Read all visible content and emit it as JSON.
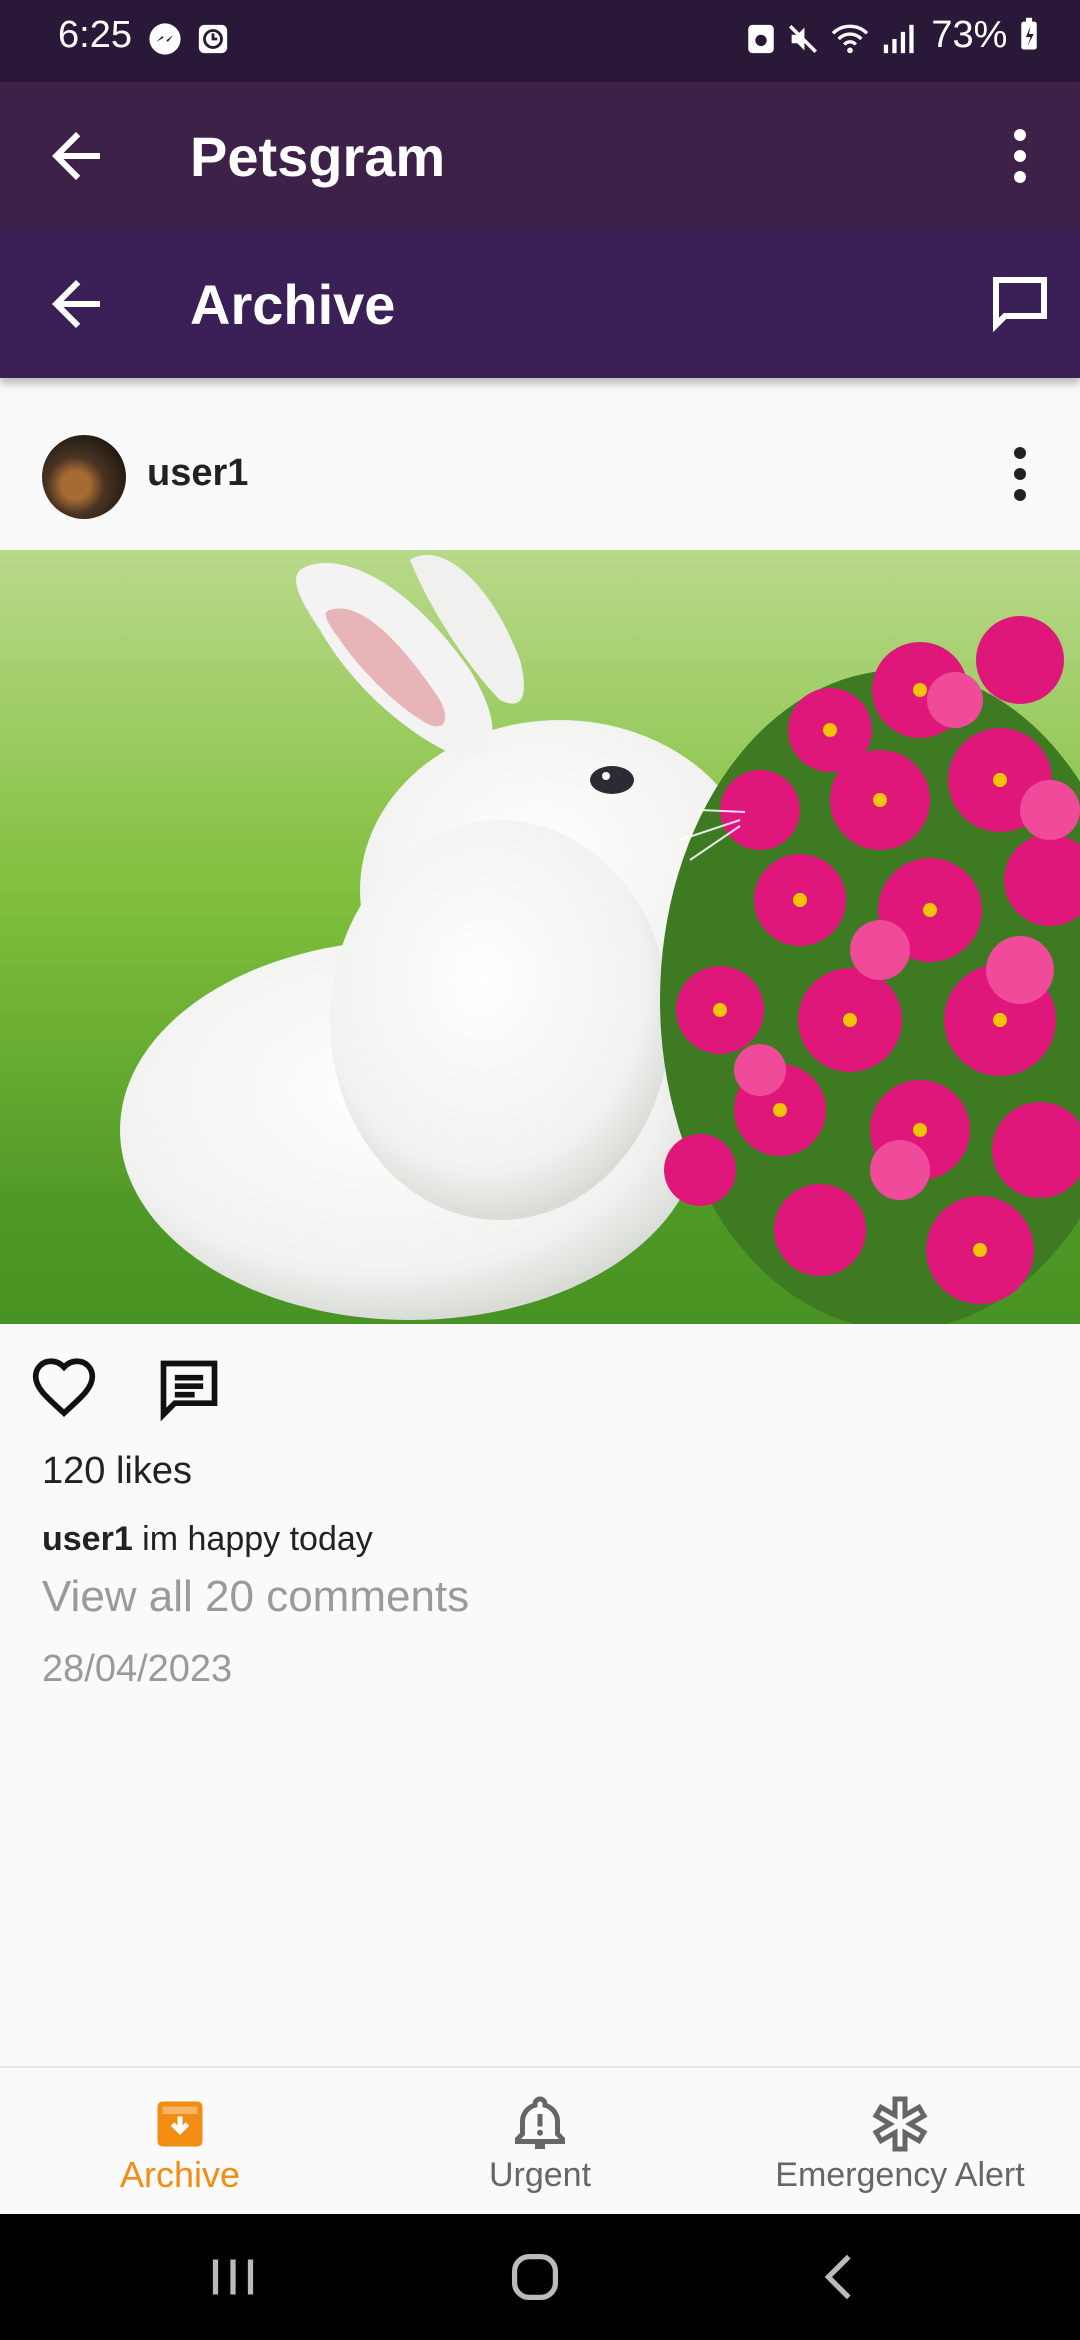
{
  "status_bar": {
    "time": "6:25",
    "battery": "73%",
    "icons": [
      "messenger-icon",
      "clock-app-icon",
      "recycle-icon",
      "mute-icon",
      "wifi-icon",
      "signal-icon",
      "battery-icon"
    ]
  },
  "app_bar": {
    "title": "Petsgram",
    "back_icon": "arrow-back-icon",
    "menu_icon": "more-vert-icon"
  },
  "archive_bar": {
    "title": "Archive",
    "back_icon": "arrow-back-icon",
    "chat_icon": "chat-bubble-icon"
  },
  "post": {
    "username": "user1",
    "likes": "120 likes",
    "caption_user": "user1",
    "caption_text": " im happy today",
    "view_comments": "View all 20 comments",
    "date": "28/04/2023",
    "image": "photo-white-rabbit-pink-flowers",
    "like_icon": "heart-outline-icon",
    "comment_icon": "comment-icon"
  },
  "bottom_nav": {
    "items": [
      {
        "label": "Archive",
        "icon": "archive-box-icon",
        "active": true
      },
      {
        "label": "Urgent",
        "icon": "bell-alert-icon",
        "active": false
      },
      {
        "label": "Emergency Alert",
        "icon": "medical-star-icon",
        "active": false
      }
    ]
  },
  "colors": {
    "status_bar": "#2a1838",
    "app_bar": "#3d2148",
    "archive_bar": "#3b1f57",
    "active_nav": "#f28c12",
    "inactive_nav": "#666666",
    "muted_text": "#9a9a9a"
  }
}
